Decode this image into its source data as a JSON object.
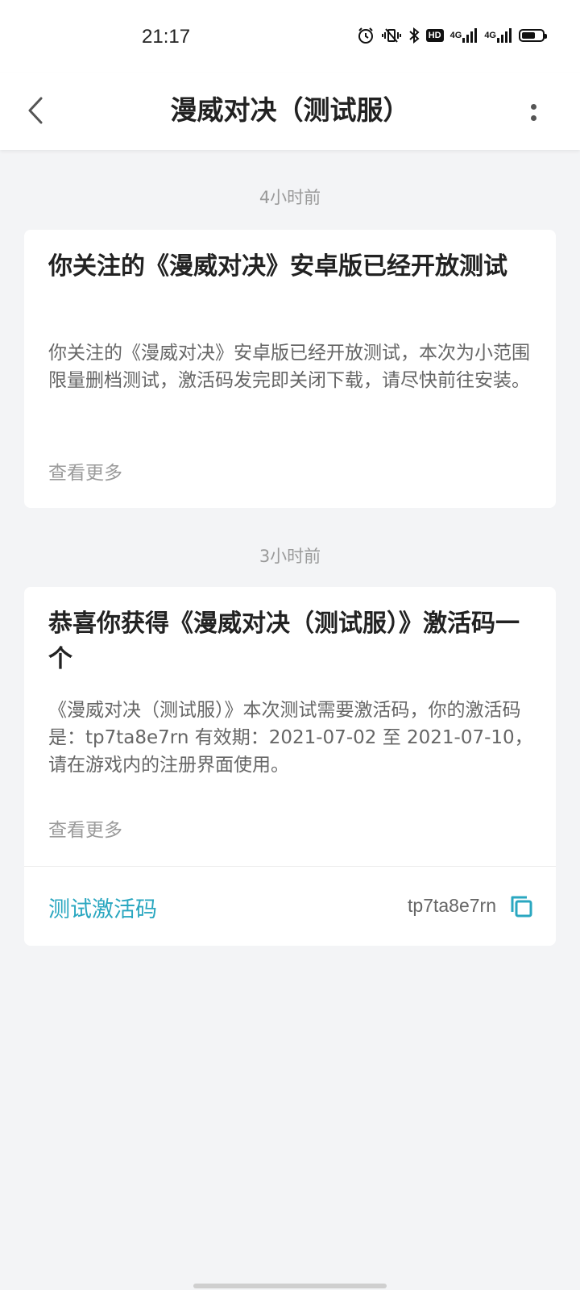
{
  "status_bar": {
    "time": "21:17",
    "icons": [
      "alarm-icon",
      "vibrate-icon",
      "bluetooth-icon",
      "hd-icon",
      "signal-4g-icon",
      "signal-4g-icon",
      "battery-icon"
    ],
    "hd_label": "HD",
    "net1": "4G",
    "net2": "4G"
  },
  "header": {
    "title": "漫威对决（测试服）"
  },
  "messages": [
    {
      "time": "4小时前",
      "title": "你关注的《漫威对决》安卓版已经开放测试",
      "body": "你关注的《漫威对决》安卓版已经开放测试，本次为小范围限量删档测试，激活码发完即关闭下载，请尽快前往安装。",
      "more": "查看更多"
    },
    {
      "time": "3小时前",
      "title": "恭喜你获得《漫威对决（测试服）》激活码一个",
      "body": "《漫威对决（测试服）》本次测试需要激活码，你的激活码是：tp7ta8e7rn 有效期：2021-07-02 至 2021-07-10，请在游戏内的注册界面使用。",
      "more": "查看更多",
      "code_label": "测试激活码",
      "code_value": "tp7ta8e7rn"
    }
  ],
  "colors": {
    "accent": "#2aa7c0",
    "background": "#f3f4f6"
  }
}
